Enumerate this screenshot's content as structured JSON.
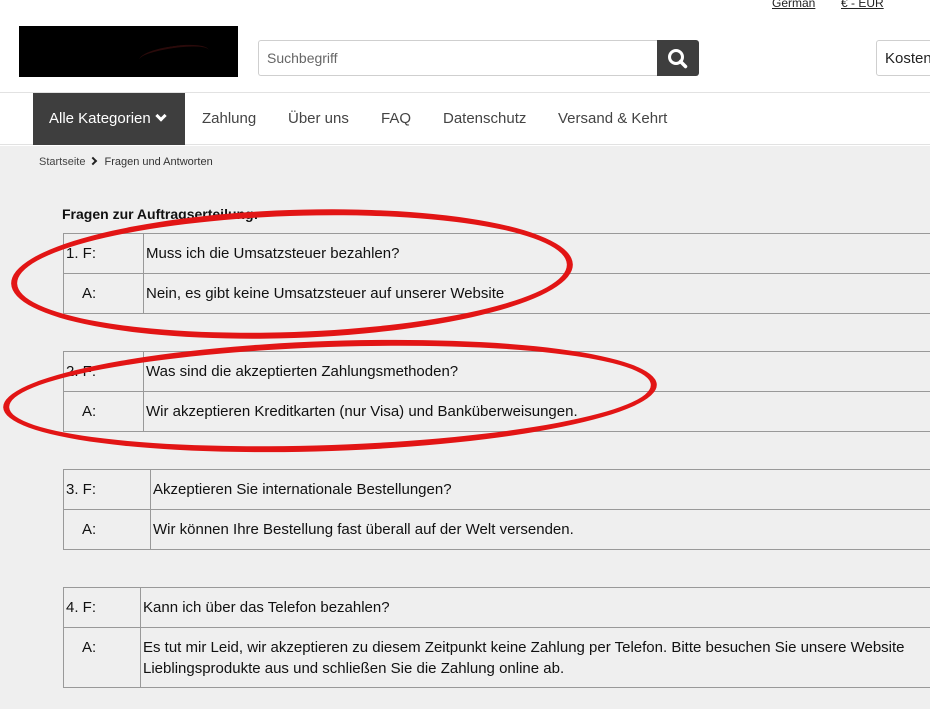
{
  "topbar": {
    "language": "German",
    "currency": "€ - EUR"
  },
  "search": {
    "placeholder": "Suchbegriff"
  },
  "cart": {
    "label": "Kosten"
  },
  "nav": {
    "categories_label": "Alle Kategorien",
    "links": [
      "Zahlung",
      "Über uns",
      "FAQ",
      "Datenschutz",
      "Versand & Kehrt"
    ]
  },
  "breadcrumb": {
    "home": "Startseite",
    "current": "Fragen und Antworten"
  },
  "faq": {
    "section_title": "Fragen zur Auftragserteilung:",
    "items": [
      {
        "q_label": "1. F:",
        "question": "Muss ich die Umsatzsteuer bezahlen?",
        "a_label": "A:",
        "answer": "Nein, es gibt keine Umsatzsteuer auf unserer Website"
      },
      {
        "q_label": "2. F:",
        "question": "Was sind die akzeptierten Zahlungsmethoden?",
        "a_label": "A:",
        "answer": "Wir akzeptieren Kreditkarten (nur Visa) und Banküberweisungen."
      },
      {
        "q_label": "3. F:",
        "question": "Akzeptieren Sie internationale Bestellungen?",
        "a_label": "A:",
        "answer": "Wir können Ihre Bestellung fast überall auf der Welt versenden."
      },
      {
        "q_label": "4. F:",
        "question": "Kann ich über das Telefon bezahlen?",
        "a_label": "A:",
        "answer_line1": "Es tut mir Leid, wir akzeptieren zu diesem Zeitpunkt keine Zahlung per Telefon. Bitte besuchen Sie unsere Website",
        "answer_line2": "Lieblingsprodukte aus und schließen Sie die Zahlung online ab."
      }
    ]
  },
  "colors": {
    "annotation": "#e21515",
    "nav_dark": "#3e3e3e",
    "content_bg": "#efefef"
  },
  "icons": {
    "search": "search-icon",
    "chevron": "chevron-down-icon",
    "breadcrumb_sep": "chevron-right-icon"
  }
}
